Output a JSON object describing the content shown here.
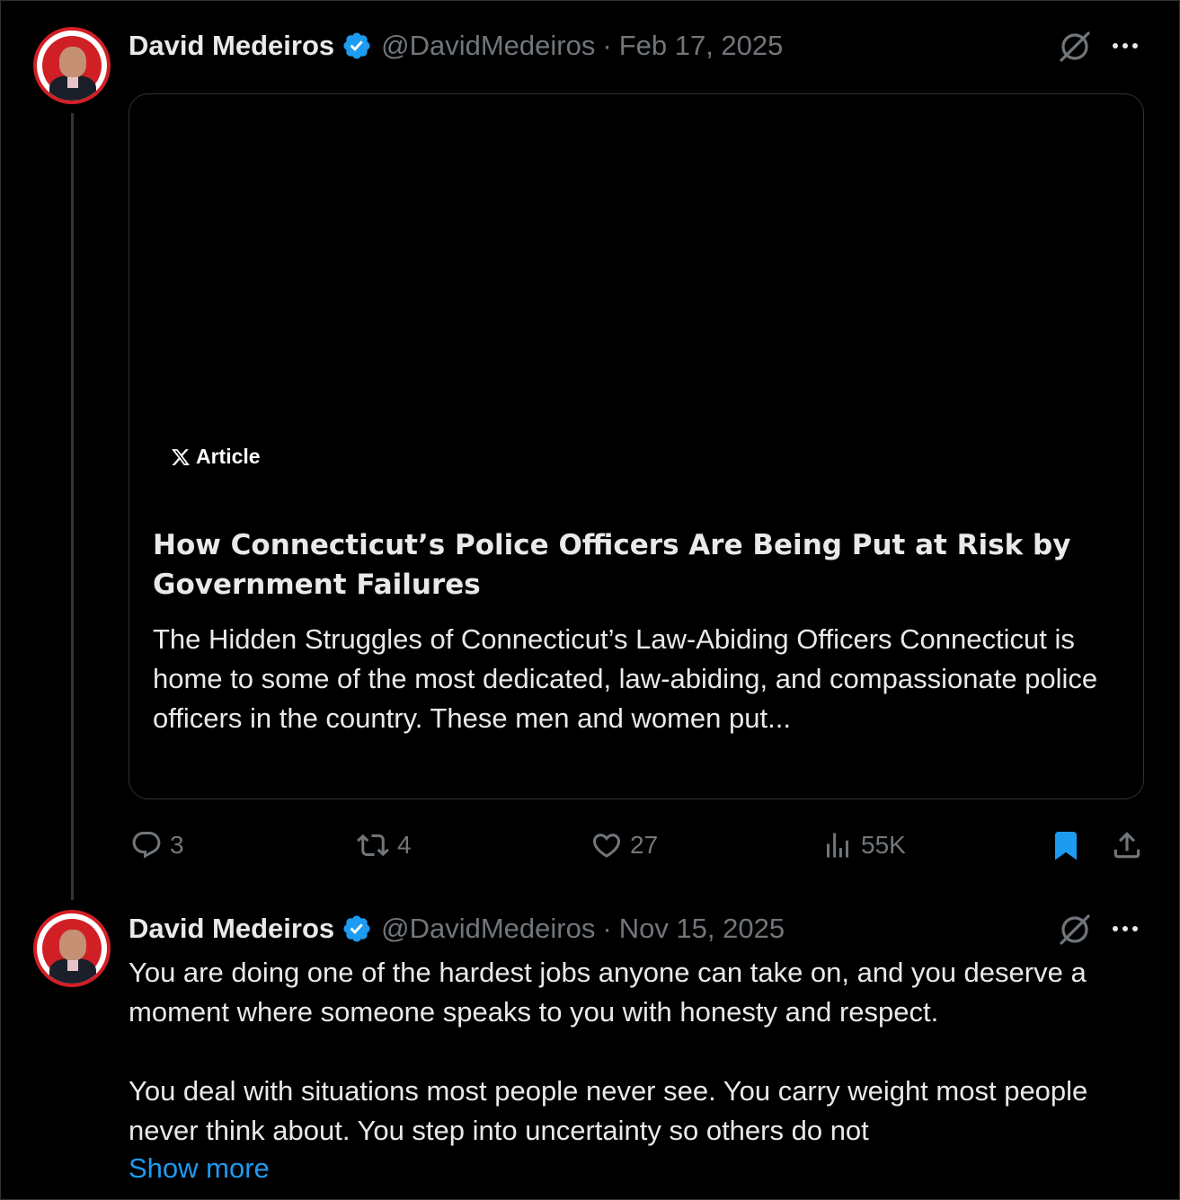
{
  "colors": {
    "accent": "#1d9bf0",
    "muted": "#71767b",
    "text": "#e7e9ea",
    "background": "#000000"
  },
  "posts": [
    {
      "author": "David Medeiros",
      "handle": "@DavidMedeiros",
      "separator": "·",
      "date": "Feb 17, 2025",
      "avatar_icon": "avatar-icon",
      "article": {
        "badge": "Article",
        "title": "How Connecticut’s Police Officers Are Being Put at Risk by Government Failures",
        "snippet": "The Hidden Struggles of Connecticut’s Law-Abiding Officers Connecticut is home to some of the most dedicated, law-abiding, and compassionate police officers in the country. These men and women put..."
      },
      "stats": {
        "replies": "3",
        "reposts": "4",
        "likes": "27",
        "views": "55K"
      },
      "bookmarked": true
    },
    {
      "author": "David Medeiros",
      "handle": "@DavidMedeiros",
      "separator": "·",
      "date": "Nov 15, 2025",
      "avatar_icon": "avatar-icon",
      "paragraph1": "You are doing one of the hardest jobs anyone can take on, and you deserve a moment where someone speaks to you with honesty and respect.",
      "paragraph2": "You deal with situations most people never see. You carry weight most people never think about. You step into uncertainty so others do not",
      "show_more": "Show more"
    }
  ]
}
